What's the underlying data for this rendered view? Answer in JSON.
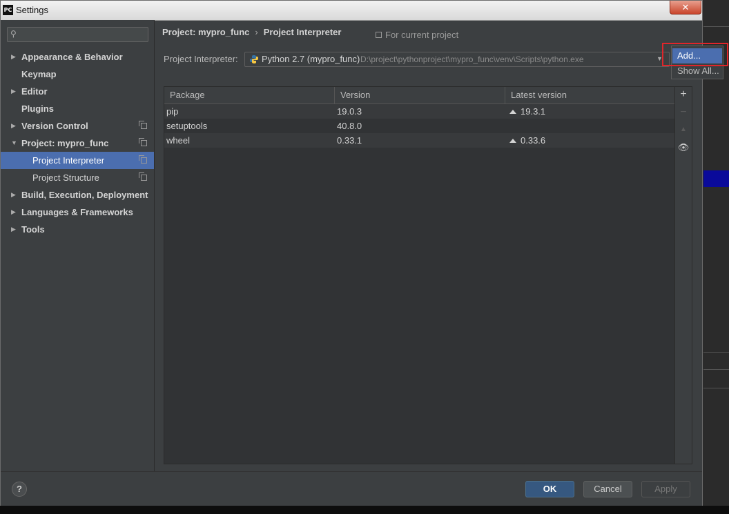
{
  "window": {
    "title": "Settings",
    "icon_text": "PC",
    "close_label": "✕"
  },
  "search": {
    "placeholder": "",
    "value": ""
  },
  "sidebar": {
    "items": [
      {
        "label": "Appearance & Behavior",
        "expandable": true,
        "expanded": false
      },
      {
        "label": "Keymap",
        "expandable": false
      },
      {
        "label": "Editor",
        "expandable": true,
        "expanded": false
      },
      {
        "label": "Plugins",
        "expandable": false
      },
      {
        "label": "Version Control",
        "expandable": true,
        "expanded": false
      },
      {
        "label": "Project: mypro_func",
        "expandable": true,
        "expanded": true
      },
      {
        "label": "Project Interpreter",
        "child": true,
        "selected": true
      },
      {
        "label": "Project Structure",
        "child": true
      },
      {
        "label": "Build, Execution, Deployment",
        "expandable": true,
        "expanded": false
      },
      {
        "label": "Languages & Frameworks",
        "expandable": true,
        "expanded": false
      },
      {
        "label": "Tools",
        "expandable": true,
        "expanded": false
      }
    ]
  },
  "breadcrumb": {
    "project": "Project: mypro_func",
    "separator": "›",
    "page": "Project Interpreter"
  },
  "for_current_project": "For current project",
  "interpreter": {
    "label": "Project Interpreter:",
    "name": "Python 2.7 (mypro_func)",
    "path": "D:\\project\\pythonproject\\mypro_func\\venv\\Scripts\\python.exe"
  },
  "popup": {
    "add": "Add...",
    "show_all": "Show All..."
  },
  "table": {
    "headers": [
      "Package",
      "Version",
      "Latest version"
    ],
    "rows": [
      {
        "package": "pip",
        "version": "19.0.3",
        "latest": "19.3.1",
        "upgrade": true
      },
      {
        "package": "setuptools",
        "version": "40.8.0",
        "latest": "",
        "upgrade": false
      },
      {
        "package": "wheel",
        "version": "0.33.1",
        "latest": "0.33.6",
        "upgrade": true
      }
    ]
  },
  "tools": {
    "add": "+",
    "remove": "−",
    "upgrade": "▲",
    "show": "👁"
  },
  "footer": {
    "help": "?",
    "ok": "OK",
    "cancel": "Cancel",
    "apply": "Apply"
  },
  "colors": {
    "selection": "#4b6eaf",
    "highlight_box": "#e0252a",
    "ok_button": "#365880"
  }
}
